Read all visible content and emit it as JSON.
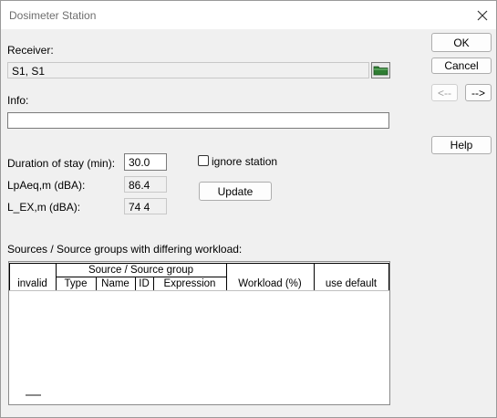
{
  "window": {
    "title": "Dosimeter Station",
    "close_icon": "close-icon"
  },
  "receiver": {
    "label": "Receiver:",
    "value": "S1, S1",
    "browse_icon": "folder-icon"
  },
  "info": {
    "label": "Info:",
    "value": ""
  },
  "buttons": {
    "ok": "OK",
    "cancel": "Cancel",
    "prev": "<--",
    "next": "-->",
    "help": "Help",
    "update": "Update"
  },
  "fields": {
    "duration": {
      "label": "Duration of stay (min):",
      "value": "30.0"
    },
    "lpaeq": {
      "label": "LpAeq,m (dBA):",
      "value": "86.4"
    },
    "lex": {
      "label": "L_EX,m (dBA):",
      "value": "74 4"
    }
  },
  "ignore_station": {
    "label": "ignore station",
    "checked": false
  },
  "sources": {
    "label": "Sources / Source groups with differing workload:",
    "group_header": "Source / Source group",
    "columns": [
      "invalid",
      "Type",
      "Name",
      "ID",
      "Expression",
      "Workload (%)",
      "use default"
    ],
    "rows": []
  },
  "colors": {
    "folder_icon": "#2e7d32",
    "window_bg": "#f0f0f0",
    "title_text": "#6e6e6e"
  }
}
